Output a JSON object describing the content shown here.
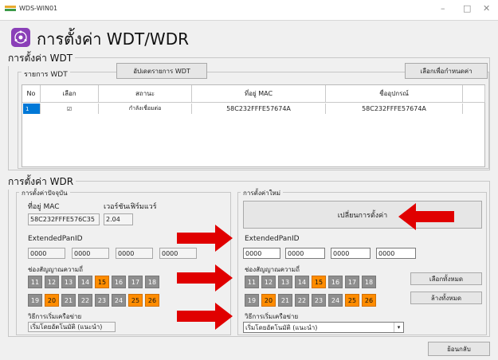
{
  "window": {
    "title": "WDS-WIN01",
    "minimize": "–",
    "maximize": "□",
    "close": "✕"
  },
  "header": {
    "title": "การตั้งค่า WDT/WDR"
  },
  "wdt": {
    "group_label": "การตั้งค่า WDT",
    "list_label": "รายการ WDT",
    "update_button": "อัปเดตรายการ WDT",
    "select_button": "เลือกเพื่อกำหนดค่า",
    "columns": [
      "No",
      "เลือก",
      "สถานะ",
      "ที่อยู่ MAC",
      "ชื่ออุปกรณ์"
    ],
    "rows": [
      {
        "no": "1",
        "checked": "☑",
        "status": "กำลังเชื่อมต่อ",
        "mac": "58C232FFFE57674A",
        "name": "58C232FFFE57674A"
      }
    ]
  },
  "wdr": {
    "group_label": "การตั้งค่า WDR",
    "current": {
      "label": "การตั้งค่าปัจจุบัน",
      "mac_label": "ที่อยู่ MAC",
      "mac_value": "58C232FFFE576C35",
      "fw_label": "เวอร์ชันเฟิร์มแวร์",
      "fw_value": "2.04",
      "panid_label": "ExtendedPanID",
      "panid": [
        "0000",
        "0000",
        "0000",
        "0000"
      ],
      "channel_label": "ช่องสัญญาณความถี่",
      "channels_row1": [
        "11",
        "12",
        "13",
        "14",
        "15",
        "16",
        "17",
        "18"
      ],
      "channels_row2": [
        "19",
        "20",
        "21",
        "22",
        "23",
        "24",
        "25",
        "26"
      ],
      "active_channels": [
        "15",
        "20",
        "25",
        "26"
      ],
      "method_label": "วิธีการเริ่มเครือข่าย",
      "method_value": "เริ่มโดยอัตโนมัติ (แนะนำ)"
    },
    "new": {
      "label": "การตั้งค่าใหม่",
      "change_button": "เปลี่ยนการตั้งค่า",
      "panid_label": "ExtendedPanID",
      "panid": [
        "0000",
        "0000",
        "0000",
        "0000"
      ],
      "channel_label": "ช่องสัญญาณความถี่",
      "channels_row1": [
        "11",
        "12",
        "13",
        "14",
        "15",
        "16",
        "17",
        "18"
      ],
      "channels_row2": [
        "19",
        "20",
        "21",
        "22",
        "23",
        "24",
        "25",
        "26"
      ],
      "active_channels": [
        "15",
        "20",
        "25",
        "26"
      ],
      "select_all_button": "เลือกทั้งหมด",
      "clear_all_button": "ล้างทั้งหมด",
      "method_label": "วิธีการเริ่มเครือข่าย",
      "method_value": "เริ่มโดยอัตโนมัติ (แนะนำ)"
    }
  },
  "footer": {
    "back_button": "ย้อนกลับ"
  },
  "colors": {
    "active_channel": "#ff8c00",
    "inactive_channel": "#8e8e8e",
    "selection": "#0078d7",
    "arrow": "#e00000",
    "logo": "#8a3fb8"
  }
}
